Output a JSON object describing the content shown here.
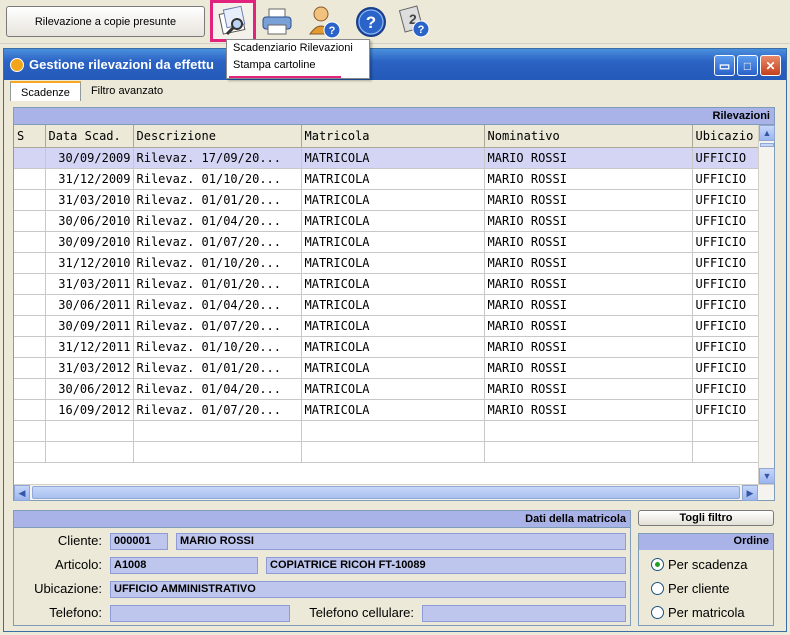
{
  "toolbar": {
    "main_button": "Rilevazione a copie presunte",
    "icons": [
      "print-preview-icon",
      "printer-icon",
      "user-help-icon",
      "help-icon",
      "info-help-icon"
    ]
  },
  "menu": {
    "items": [
      "Scadenziario Rilevazioni",
      "Stampa cartoline"
    ]
  },
  "window": {
    "title": "Gestione rilevazioni da effettu",
    "accent": "#245ab8"
  },
  "tabs": [
    "Scadenze",
    "Filtro avanzato"
  ],
  "grid": {
    "header": "Rilevazioni",
    "columns": [
      "S",
      "Data Scad.",
      "Descrizione",
      "Matricola",
      "Nominativo",
      "Ubicazio"
    ],
    "rows": [
      [
        "",
        "30/09/2009",
        "Rilevaz. 17/09/20...",
        "MATRICOLA",
        "MARIO ROSSI",
        "UFFICIO"
      ],
      [
        "",
        "31/12/2009",
        "Rilevaz. 01/10/20...",
        "MATRICOLA",
        "MARIO ROSSI",
        "UFFICIO"
      ],
      [
        "",
        "31/03/2010",
        "Rilevaz. 01/01/20...",
        "MATRICOLA",
        "MARIO ROSSI",
        "UFFICIO"
      ],
      [
        "",
        "30/06/2010",
        "Rilevaz. 01/04/20...",
        "MATRICOLA",
        "MARIO ROSSI",
        "UFFICIO"
      ],
      [
        "",
        "30/09/2010",
        "Rilevaz. 01/07/20...",
        "MATRICOLA",
        "MARIO ROSSI",
        "UFFICIO"
      ],
      [
        "",
        "31/12/2010",
        "Rilevaz. 01/10/20...",
        "MATRICOLA",
        "MARIO ROSSI",
        "UFFICIO"
      ],
      [
        "",
        "31/03/2011",
        "Rilevaz. 01/01/20...",
        "MATRICOLA",
        "MARIO ROSSI",
        "UFFICIO"
      ],
      [
        "",
        "30/06/2011",
        "Rilevaz. 01/04/20...",
        "MATRICOLA",
        "MARIO ROSSI",
        "UFFICIO"
      ],
      [
        "",
        "30/09/2011",
        "Rilevaz. 01/07/20...",
        "MATRICOLA",
        "MARIO ROSSI",
        "UFFICIO"
      ],
      [
        "",
        "31/12/2011",
        "Rilevaz. 01/10/20...",
        "MATRICOLA",
        "MARIO ROSSI",
        "UFFICIO"
      ],
      [
        "",
        "31/03/2012",
        "Rilevaz. 01/01/20...",
        "MATRICOLA",
        "MARIO ROSSI",
        "UFFICIO"
      ],
      [
        "",
        "30/06/2012",
        "Rilevaz. 01/04/20...",
        "MATRICOLA",
        "MARIO ROSSI",
        "UFFICIO"
      ],
      [
        "",
        "16/09/2012",
        "Rilevaz. 01/07/20...",
        "MATRICOLA",
        "MARIO ROSSI",
        "UFFICIO"
      ]
    ],
    "empty_rows": 2
  },
  "detail": {
    "header": "Dati della matricola",
    "cliente_label": "Cliente:",
    "cliente_code": "000001",
    "cliente_name": "MARIO ROSSI",
    "articolo_label": "Articolo:",
    "articolo_code": "A1008",
    "articolo_desc": "COPIATRICE RICOH FT-10089",
    "ubicazione_label": "Ubicazione:",
    "ubicazione_value": "UFFICIO AMMINISTRATIVO",
    "telefono_label": "Telefono:",
    "telefono_value": "",
    "cellulare_label": "Telefono cellulare:",
    "cellulare_value": ""
  },
  "toggle_filter": "Togli filtro",
  "order": {
    "header": "Ordine",
    "options": [
      "Per scadenza",
      "Per cliente",
      "Per matricola"
    ],
    "selected": 0
  }
}
